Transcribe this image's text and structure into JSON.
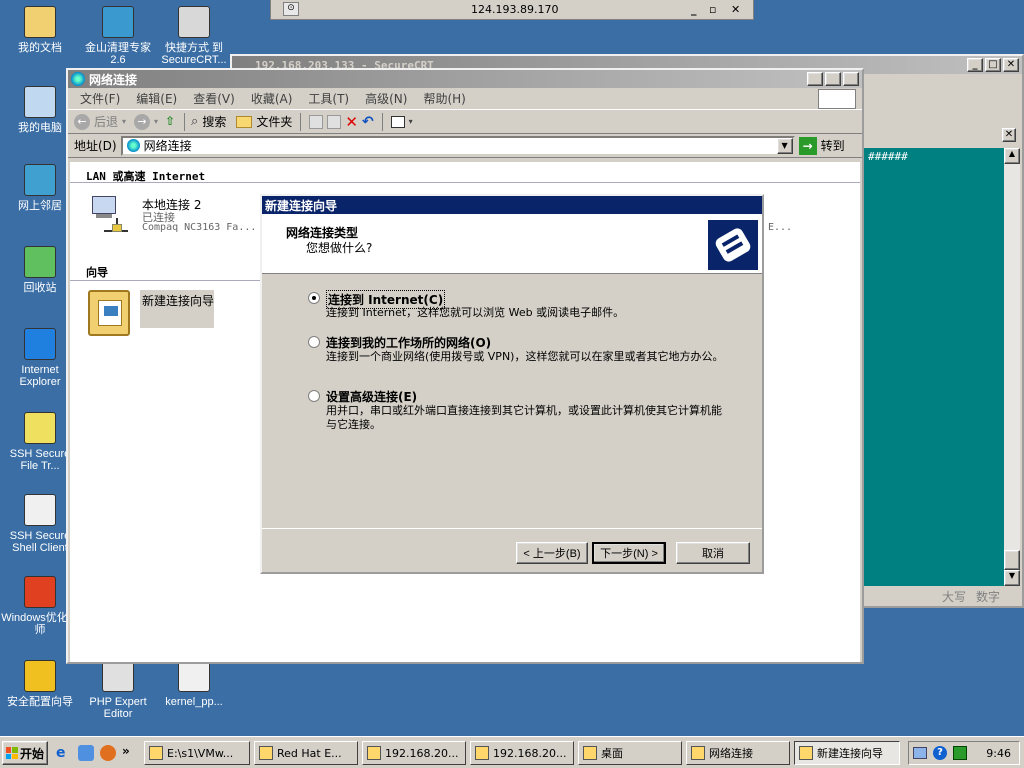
{
  "remote_bar": {
    "host": "124.193.89.170",
    "min": "_",
    "restore": "▫",
    "close": "✕"
  },
  "desktop_icons": [
    {
      "label": "我的文档",
      "icon": "my-documents-icon"
    },
    {
      "label": "金山清理专家 2.6",
      "icon": "kingsoft-cleaner-icon"
    },
    {
      "label": "快捷方式 到 SecureCRT...",
      "icon": "securecrt-shortcut-icon"
    },
    {
      "label": "我的电脑",
      "icon": "my-computer-icon"
    },
    {
      "label": "网上邻居",
      "icon": "network-places-icon"
    },
    {
      "label": "回收站",
      "icon": "recycle-bin-icon"
    },
    {
      "label": "Internet Explorer",
      "icon": "internet-explorer-icon"
    },
    {
      "label": "SSH Secure File Tr...",
      "icon": "ssh-file-transfer-icon"
    },
    {
      "label": "SSH Secure Shell Client",
      "icon": "ssh-shell-client-icon"
    },
    {
      "label": "Windows优化大师",
      "icon": "windows-optimizer-icon"
    },
    {
      "label": "安全配置向导",
      "icon": "security-wizard-icon"
    },
    {
      "label": "PHP Expert Editor",
      "icon": "php-editor-icon"
    },
    {
      "label": "kernel_pp...",
      "icon": "kernel-file-icon"
    }
  ],
  "securecrt": {
    "title": "192.168.203.133 - SecureCRT",
    "terminal_text": "######",
    "status_caps": "大写",
    "status_num": "数字"
  },
  "netconn": {
    "title": "网络连接",
    "menu": [
      "文件(F)",
      "编辑(E)",
      "查看(V)",
      "收藏(A)",
      "工具(T)",
      "高级(N)",
      "帮助(H)"
    ],
    "toolbar": {
      "back": "后退",
      "search": "搜索",
      "folders": "文件夹"
    },
    "address_label": "地址(D)",
    "address_value": "网络连接",
    "go_label": "转到",
    "section_lan": "LAN 或高速 Internet",
    "conn_name": "本地连接 2",
    "conn_status": "已连接",
    "conn_device": "Compaq NC3163 Fa...",
    "conn_device_right": "E...",
    "section_wizard": "向导",
    "wizard_item": "新建连接向导"
  },
  "wizard": {
    "title": "新建连接向导",
    "header_title": "网络连接类型",
    "header_sub": "您想做什么?",
    "options": [
      {
        "label": "连接到 Internet(C)",
        "desc": "连接到 Internet，这样您就可以浏览 Web 或阅读电子邮件。",
        "selected": true
      },
      {
        "label": "连接到我的工作场所的网络(O)",
        "desc": "连接到一个商业网络(使用拨号或 VPN)，这样您就可以在家里或者其它地方办公。",
        "selected": false
      },
      {
        "label": "设置高级连接(E)",
        "desc": "用并口，串口或红外端口直接连接到其它计算机，或设置此计算机使其它计算机能与它连接。",
        "selected": false
      }
    ],
    "btn_back": "< 上一步(B)",
    "btn_next": "下一步(N) >",
    "btn_cancel": "取消"
  },
  "taskbar": {
    "start": "开始",
    "tasks": [
      "E:\\s1\\VMw...",
      "Red Hat E...",
      "192.168.20...",
      "192.168.20...",
      "桌面",
      "网络连接",
      "新建连接向导"
    ],
    "active_task": 6,
    "clock": "9:46"
  }
}
